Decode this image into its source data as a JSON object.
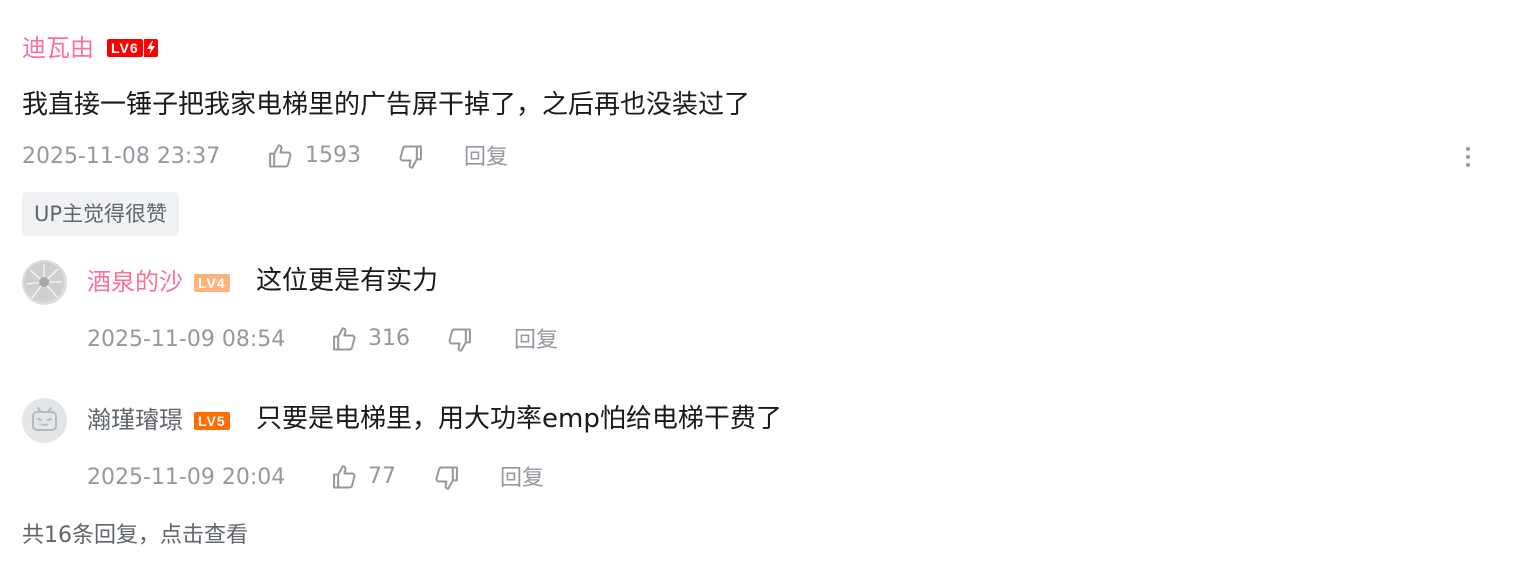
{
  "comment": {
    "username": "迪瓦由",
    "level_badge": "LV6",
    "text": "我直接一锤子把我家电梯里的广告屏干掉了，之后再也没装过了",
    "timestamp": "2025-11-08 23:37",
    "like_count": "1593",
    "reply_label": "回复",
    "up_tag": "UP主觉得很赞",
    "more_icon": "more-vertical-icon"
  },
  "replies": [
    {
      "username": "酒泉的沙",
      "level_badge": "LV4",
      "text": "这位更是有实力",
      "timestamp": "2025-11-09 08:54",
      "like_count": "316",
      "reply_label": "回复"
    },
    {
      "username": "瀚瑾璿璟",
      "level_badge": "LV5",
      "text": "只要是电梯里，用大功率emp怕给电梯干费了",
      "timestamp": "2025-11-09 20:04",
      "like_count": "77",
      "reply_label": "回复"
    }
  ],
  "view_more_text": "共16条回复，点击查看",
  "colors": {
    "username_vip": "#fb7299",
    "username_normal": "#61666d",
    "lv6": "#fe0000",
    "lv4": "#ffb37c",
    "lv5": "#ff6c00",
    "meta_gray": "#9499a0",
    "text": "#18191c"
  }
}
